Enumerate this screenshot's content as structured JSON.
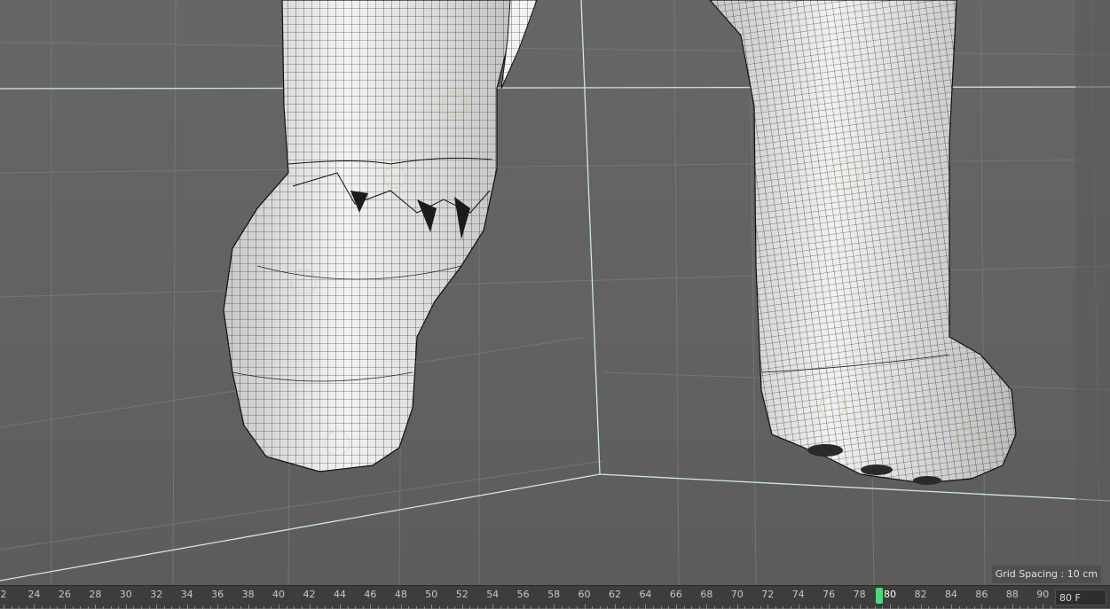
{
  "viewport": {
    "grid_spacing_label": "Grid Spacing : 10 cm"
  },
  "timeline": {
    "ticks": [
      "2",
      "24",
      "26",
      "28",
      "30",
      "32",
      "34",
      "36",
      "38",
      "40",
      "42",
      "44",
      "46",
      "48",
      "50",
      "52",
      "54",
      "56",
      "58",
      "60",
      "62",
      "64",
      "66",
      "68",
      "70",
      "72",
      "74",
      "76",
      "78",
      "80",
      "82",
      "84",
      "86",
      "88",
      "90"
    ],
    "current_frame": "80",
    "frame_field_value": "80 F"
  },
  "colors": {
    "accent": "#4cd97b",
    "viewport_bg": "#646464",
    "model_fill": "#f2f2f2",
    "axis_line": "#cfe8e0"
  }
}
